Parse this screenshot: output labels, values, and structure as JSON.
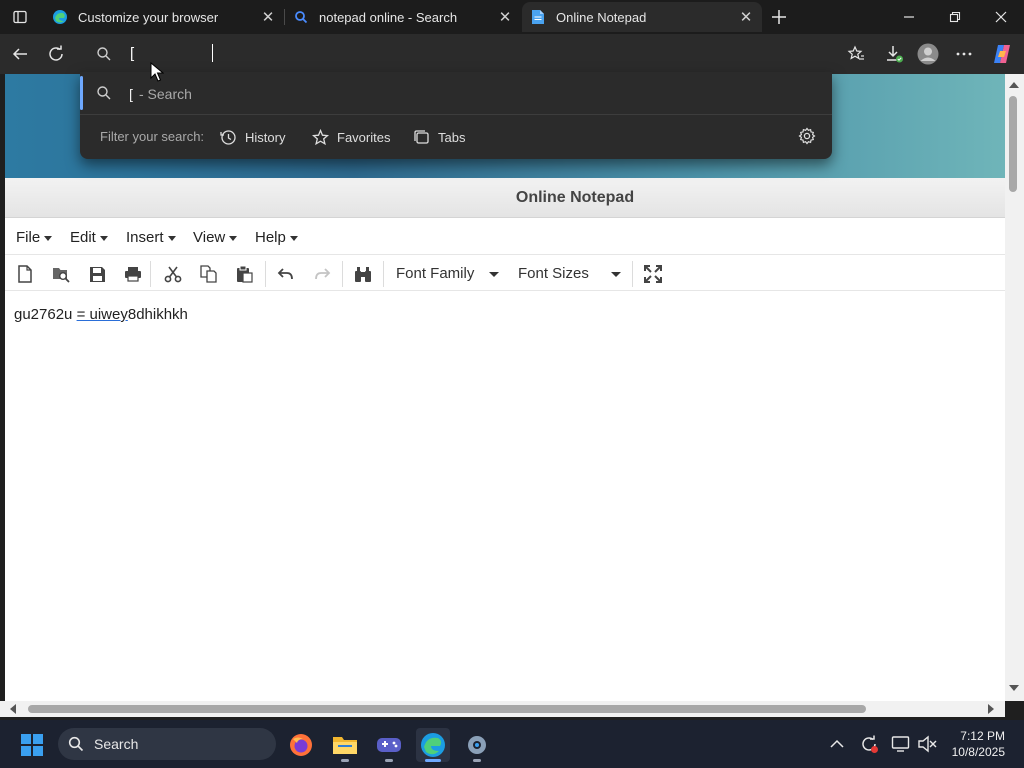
{
  "browser": {
    "tabs": [
      {
        "label": "Customize your browser",
        "active": false,
        "icon": "edge-icon"
      },
      {
        "label": "notepad online - Search",
        "active": false,
        "icon": "search-icon"
      },
      {
        "label": "Online Notepad",
        "active": true,
        "icon": "document-icon"
      }
    ],
    "address_bar": {
      "value": "["
    },
    "suggestion": {
      "query": "[",
      "suffix": "- Search"
    },
    "filter": {
      "label": "Filter your search:",
      "chips": [
        "History",
        "Favorites",
        "Tabs"
      ]
    }
  },
  "notepad": {
    "title": "Online Notepad",
    "menus": [
      "File",
      "Edit",
      "Insert",
      "View",
      "Help"
    ],
    "font_family_label": "Font Family",
    "font_size_label": "Font Sizes",
    "content": {
      "part1": "gu2762u ",
      "part2": "= uiwey",
      "part3": "8dhikhkh"
    }
  },
  "taskbar": {
    "search_label": "Search",
    "time": "7:12 PM",
    "date": "10/8/2025"
  },
  "colors": {
    "accent": "#6ea8fe",
    "banner": "#2d7aa2"
  }
}
